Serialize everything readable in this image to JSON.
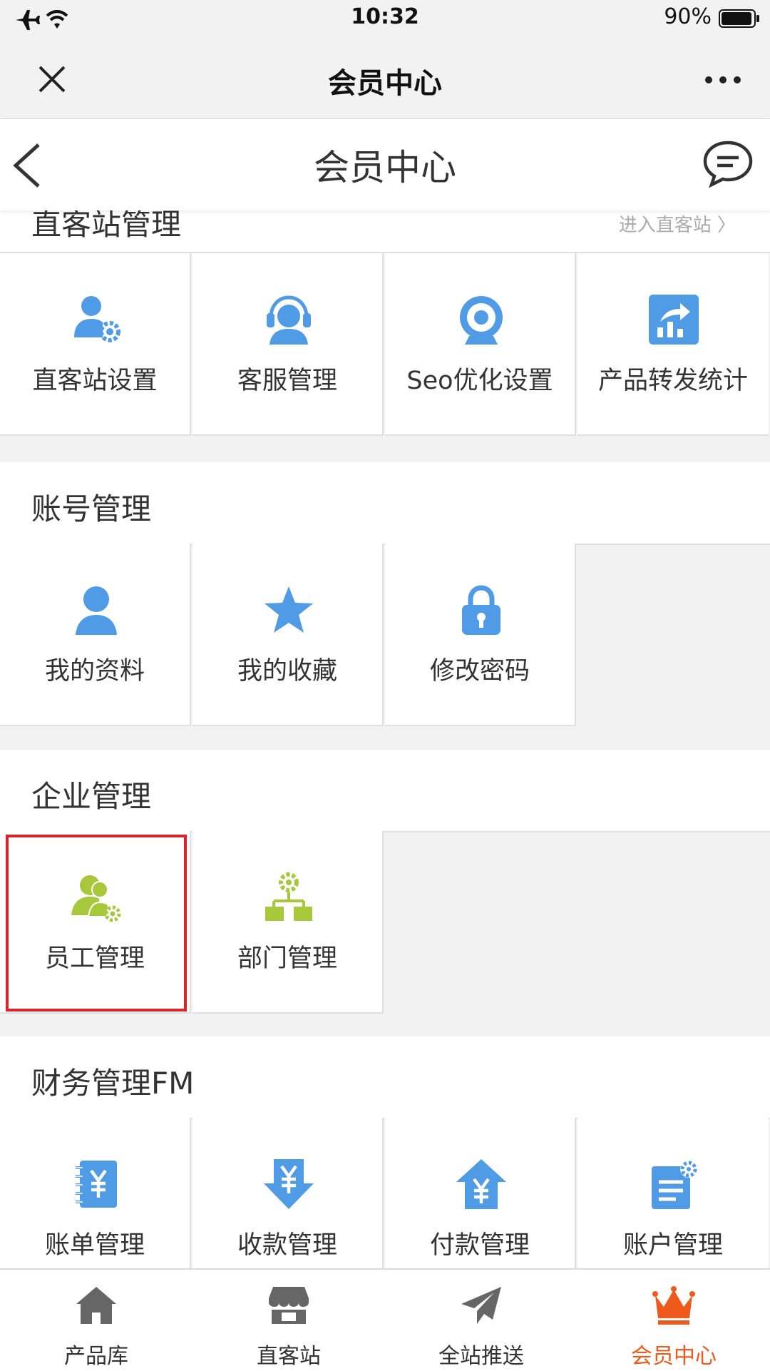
{
  "status_bar": {
    "time": "10:32",
    "battery": "90%"
  },
  "wechat_bar": {
    "title": "会员中心"
  },
  "app_header": {
    "title": "会员中心"
  },
  "colors": {
    "blue": "#4f9be6",
    "green": "#a6c83a",
    "orange": "#ee5a1c",
    "highlight": "#d9232d"
  },
  "sections": [
    {
      "title": "直客站管理",
      "link": "进入直客站 〉",
      "items": [
        {
          "label": "直客站设置",
          "icon": "user-settings-icon"
        },
        {
          "label": "客服管理",
          "icon": "headset-agent-icon"
        },
        {
          "label": "Seo优化设置",
          "icon": "target-icon"
        },
        {
          "label": "产品转发统计",
          "icon": "share-chart-icon"
        }
      ]
    },
    {
      "title": "账号管理",
      "items": [
        {
          "label": "我的资料",
          "icon": "user-icon"
        },
        {
          "label": "我的收藏",
          "icon": "star-icon"
        },
        {
          "label": "修改密码",
          "icon": "lock-icon"
        }
      ]
    },
    {
      "title": "企业管理",
      "items": [
        {
          "label": "员工管理",
          "icon": "staff-settings-icon"
        },
        {
          "label": "部门管理",
          "icon": "org-chart-icon"
        }
      ]
    },
    {
      "title": "财务管理FM",
      "items": [
        {
          "label": "账单管理",
          "icon": "bill-icon"
        },
        {
          "label": "收款管理",
          "icon": "receive-money-icon"
        },
        {
          "label": "付款管理",
          "icon": "payment-icon"
        },
        {
          "label": "账户管理",
          "icon": "account-doc-icon"
        }
      ]
    }
  ],
  "tab_bar": [
    {
      "label": "产品库",
      "icon": "home-icon"
    },
    {
      "label": "直客站",
      "icon": "store-icon"
    },
    {
      "label": "全站推送",
      "icon": "paper-plane-icon"
    },
    {
      "label": "会员中心",
      "icon": "crown-icon",
      "active": true
    }
  ]
}
